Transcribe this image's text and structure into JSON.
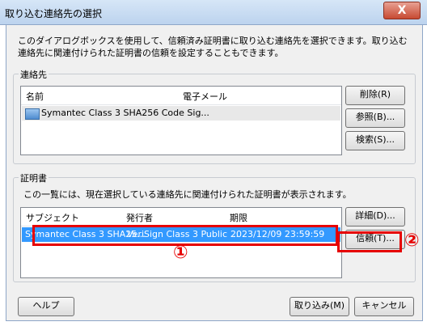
{
  "window": {
    "title": "取り込む連絡先の選択",
    "close_glyph": "X"
  },
  "description": "このダイアログボックスを使用して、信頼済み証明書に取り込む連絡先を選択できます。取り込む連絡先に関連付けられた証明書の信頼を設定することもできます。",
  "contacts": {
    "group_label": "連絡先",
    "columns": [
      "名前",
      "電子メール"
    ],
    "rows": [
      {
        "name": "Symantec Class 3 SHA256 Code Sig...",
        "email": "",
        "icon": "certificate-icon"
      }
    ],
    "buttons": {
      "delete": "削除(R)",
      "browse": "参照(B)...",
      "search": "検索(S)..."
    }
  },
  "certificates": {
    "group_label": "証明書",
    "info": "この一覧には、現在選択している連絡先に関連付けられた証明書が表示されます。",
    "columns": [
      "サブジェクト",
      "発行者",
      "期限"
    ],
    "rows": [
      {
        "subject": "Symantec Class 3 SHA25...",
        "issuer": "VeriSign Class 3 Public ...",
        "expires": "2023/12/09 23:59:59"
      }
    ],
    "buttons": {
      "details": "詳細(D)...",
      "trust": "信頼(T)..."
    }
  },
  "footer": {
    "help": "ヘルプ",
    "import": "取り込み(M)",
    "cancel": "キャンセル"
  },
  "annotations": {
    "marker_1": "①",
    "marker_2": "②"
  },
  "colors": {
    "highlight": "#3399ff",
    "annotation_red": "#e60000"
  }
}
